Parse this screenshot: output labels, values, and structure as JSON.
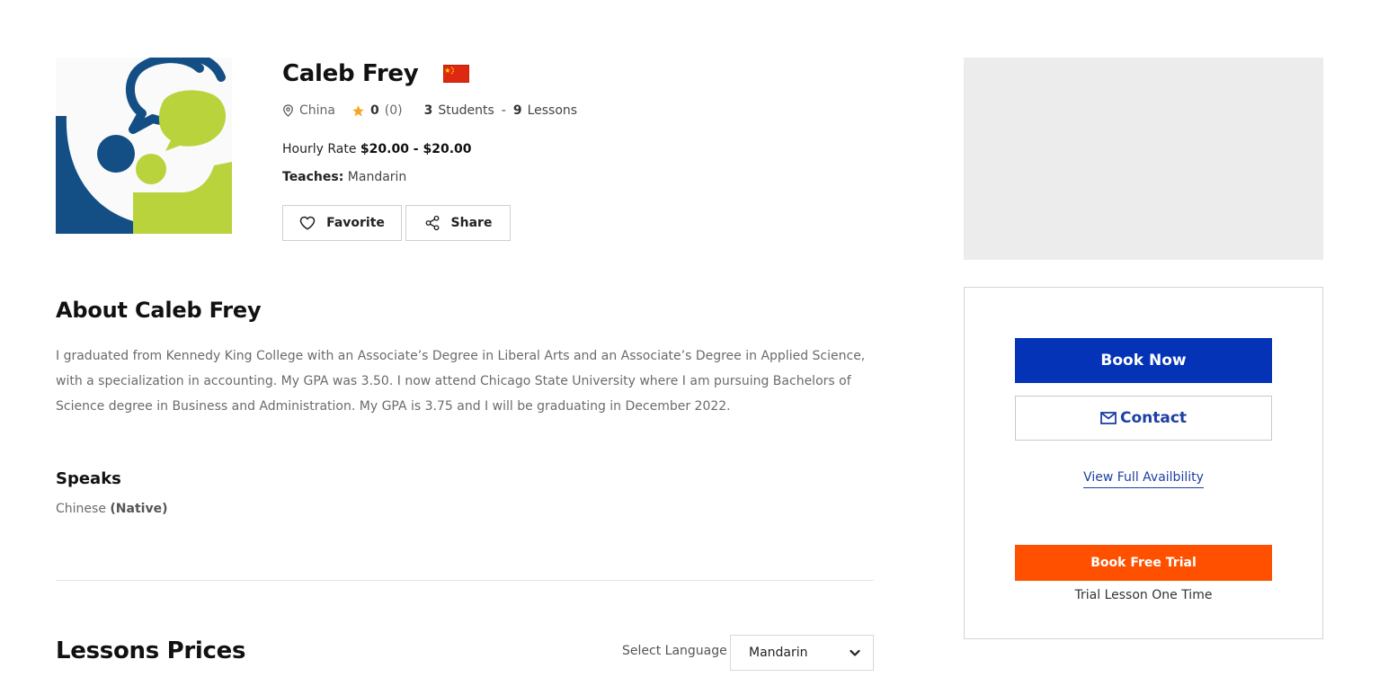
{
  "profile": {
    "name": "Caleb Frey",
    "flag_icon": "china-flag-icon",
    "country": "China",
    "rating": "0",
    "reviews": "(0)",
    "students_count": "3",
    "students_label": "Students",
    "separator": "-",
    "lessons_count": "9",
    "lessons_label": "Lessons",
    "hourly_rate_label": "Hourly Rate",
    "hourly_rate_value": "$20.00 - $20.00",
    "teaches_label": "Teaches:",
    "teaches_value": "Mandarin",
    "favorite_label": "Favorite",
    "share_label": "Share"
  },
  "about": {
    "title": "About Caleb Frey",
    "text": "I graduated from Kennedy King College with an Associate’s Degree in Liberal Arts and an Associate’s Degree in Applied Science, with a specialization in accounting. My GPA was 3.50. I now attend Chicago State University where I am pursuing Bachelors of Science degree in Business and Administration. My GPA is 3.75 and I will be graduating in December 2022."
  },
  "speaks": {
    "title": "Speaks",
    "language": "Chinese",
    "level": "(Native)"
  },
  "prices": {
    "title": "Lessons Prices",
    "select_label": "Select Language",
    "selected_language": "Mandarin"
  },
  "booking": {
    "book_now_label": "Book Now",
    "contact_label": "Contact",
    "availability_link": "View Full Availbility",
    "free_trial_label": "Book Free Trial",
    "trial_note": "Trial Lesson One Time"
  },
  "colors": {
    "primary_blue": "#0433b7",
    "link_blue": "#1e40a0",
    "trial_orange": "#ff5000",
    "star_yellow": "#f5a623",
    "logo_navy": "#134e85",
    "logo_green": "#b8d33c"
  },
  "icons": {
    "location": "map-pin-icon",
    "rating": "star-icon",
    "favorite": "heart-icon",
    "share": "share-icon",
    "contact": "envelope-icon",
    "select": "chevron-down-icon"
  }
}
